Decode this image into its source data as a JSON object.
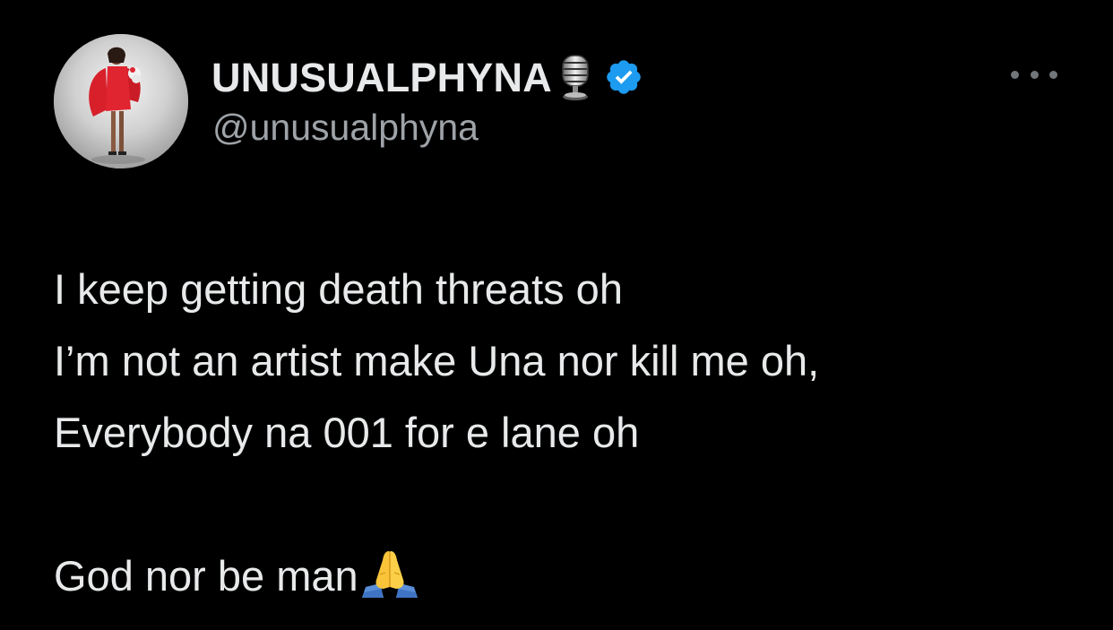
{
  "user": {
    "display_name": "UNUSUALPHYNA",
    "handle": "@unusualphyna",
    "badge_icon": "microphone-icon",
    "verified_icon": "verified-badge-icon",
    "verified_color": "#1d9bf0"
  },
  "tweet": {
    "lines": [
      "I keep getting death threats oh",
      "I’m not an artist make Una nor kill me oh,",
      "Everybody na 001 for e lane oh"
    ],
    "closing_line": "God nor be man",
    "closing_emoji": "folded-hands-icon"
  },
  "actions": {
    "more_icon": "more-options-icon"
  },
  "colors": {
    "background": "#000000",
    "text": "#e7e9ea",
    "secondary_text": "#9ea3a8"
  }
}
